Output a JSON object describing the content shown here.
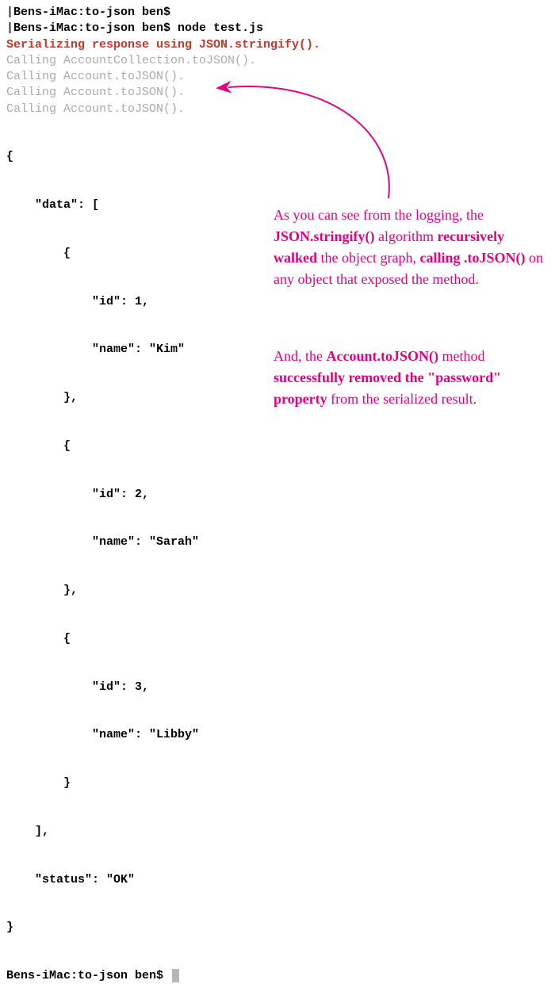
{
  "terminal": {
    "prompt_blank": "Bens-iMac:to-json ben$",
    "prompt_cmd": "Bens-iMac:to-json ben$ node test.js",
    "serializing": "Serializing response using JSON.stringify().",
    "calling_collection": "Calling AccountCollection.toJSON().",
    "calling_account": "Calling Account.toJSON().",
    "prompt_final": "Bens-iMac:to-json ben$ "
  },
  "json_output": {
    "l0": "{",
    "l1": "    \"data\": [",
    "l2": "        {",
    "l3": "            \"id\": 1,",
    "l4": "            \"name\": \"Kim\"",
    "l5": "        },",
    "l6": "        {",
    "l7": "            \"id\": 2,",
    "l8": "            \"name\": \"Sarah\"",
    "l9": "        },",
    "l10": "        {",
    "l11": "            \"id\": 3,",
    "l12": "            \"name\": \"Libby\"",
    "l13": "        }",
    "l14": "    ],",
    "l15": "    \"status\": \"OK\"",
    "l16": "}"
  },
  "annotation": {
    "a1_p1": "As you can see from the logging, the ",
    "a1_s1": "JSON.stringify()",
    "a1_p2": " algorithm ",
    "a1_s2": "recursively walked",
    "a1_p3": " the object graph, ",
    "a1_s3": "calling .toJSON()",
    "a1_p4": " on any object that exposed the method.",
    "a2_p1": "And, the ",
    "a2_s1": "Account.toJSON()",
    "a2_p2": " method ",
    "a2_s2": "successfully removed the \"password\" property",
    "a2_p3": " from the serialized result."
  }
}
